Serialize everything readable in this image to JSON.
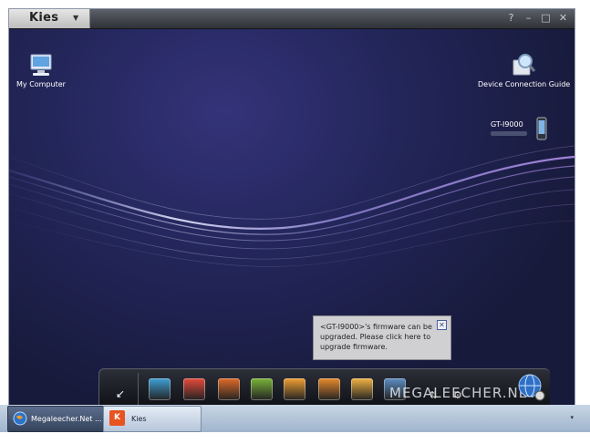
{
  "window": {
    "app_name": "Kies",
    "dropdown_icon": "chevron-down-icon",
    "controls": [
      "?",
      "–",
      "□",
      "✕"
    ]
  },
  "desktop": {
    "my_computer": {
      "label": "My Computer",
      "icon": "computer-icon"
    },
    "connection_guide": {
      "label": "Device Connection Guide",
      "icon": "magnifier-guide-icon"
    },
    "device": {
      "label": "GT-I9000",
      "icon": "phone-icon"
    }
  },
  "popup": {
    "text": "<GT-I9000>'s firmware can be upgraded. Please click here to upgrade firmware.",
    "close_label": "✕"
  },
  "dock": {
    "items": [
      {
        "name": "media-apps-icon",
        "color": "#3fa0d6"
      },
      {
        "name": "rainbow-triangle-icon",
        "color": "#e64a3b"
      },
      {
        "name": "phone-call-icon",
        "color": "#e06a28"
      },
      {
        "name": "calendar-icon",
        "color": "#7ab33a"
      },
      {
        "name": "mail-icon",
        "color": "#f0a032"
      },
      {
        "name": "notes-icon",
        "color": "#e88b2c"
      },
      {
        "name": "photo-icon",
        "color": "#f2b343"
      },
      {
        "name": "photo-album-icon",
        "color": "#5d8fc4"
      }
    ]
  },
  "watermark": "MEGALEECHER.NET",
  "taskbar": {
    "items": [
      {
        "label": "Megaleecher.Net ...",
        "active": false
      },
      {
        "label": "Kies",
        "active": true
      }
    ]
  },
  "colors": {
    "desktop_bg": "#1b1f3b",
    "popup_bg": "#d0d0d3",
    "taskbar_bg": "#b3c4d8",
    "kies_icon_orange": "#e8531f"
  }
}
